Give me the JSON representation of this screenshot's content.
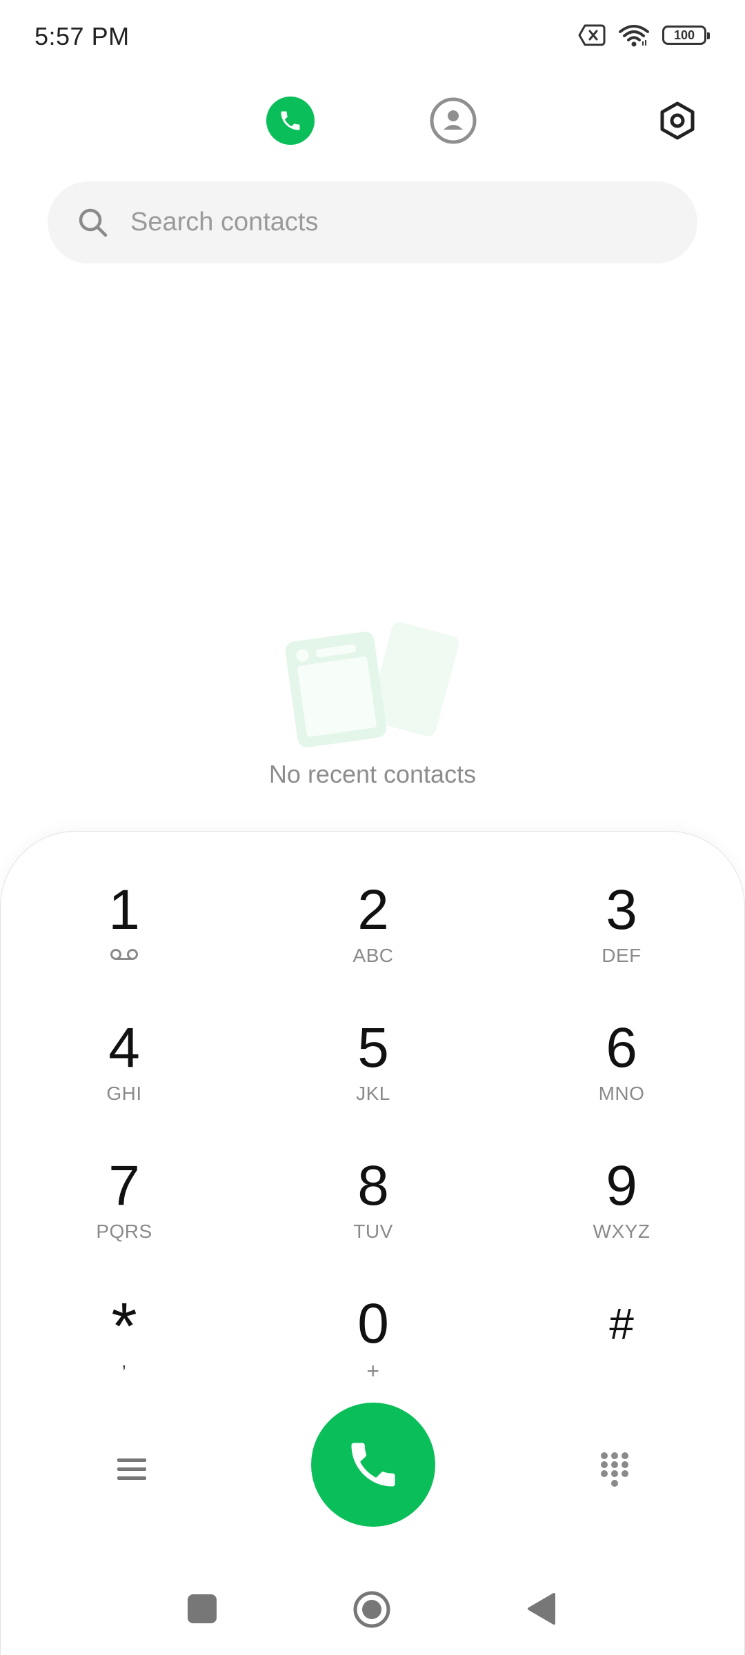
{
  "status_bar": {
    "time": "5:57 PM",
    "battery_level": "100",
    "icons": [
      "sim-card-error-icon",
      "wifi-icon",
      "battery-icon"
    ]
  },
  "top_nav": {
    "active_tab": "phone",
    "tabs": [
      {
        "id": "phone",
        "icon": "phone-icon"
      },
      {
        "id": "contacts",
        "icon": "person-icon"
      }
    ],
    "settings_icon": "settings-gear-icon"
  },
  "search": {
    "placeholder": "Search contacts",
    "value": ""
  },
  "recents": {
    "empty_message": "No recent contacts"
  },
  "keypad": {
    "keys": [
      {
        "digit": "1",
        "letters": ""
      },
      {
        "digit": "2",
        "letters": "ABC"
      },
      {
        "digit": "3",
        "letters": "DEF"
      },
      {
        "digit": "4",
        "letters": "GHI"
      },
      {
        "digit": "5",
        "letters": "JKL"
      },
      {
        "digit": "6",
        "letters": "MNO"
      },
      {
        "digit": "7",
        "letters": "PQRS"
      },
      {
        "digit": "8",
        "letters": "TUV"
      },
      {
        "digit": "9",
        "letters": "WXYZ"
      },
      {
        "digit": "*",
        "letters": ","
      },
      {
        "digit": "0",
        "letters": "+"
      },
      {
        "digit": "#",
        "letters": ""
      }
    ]
  },
  "colors": {
    "accent_green": "#0abe5a",
    "search_background": "#f4f4f4",
    "secondary_text": "#8a8a8a"
  }
}
